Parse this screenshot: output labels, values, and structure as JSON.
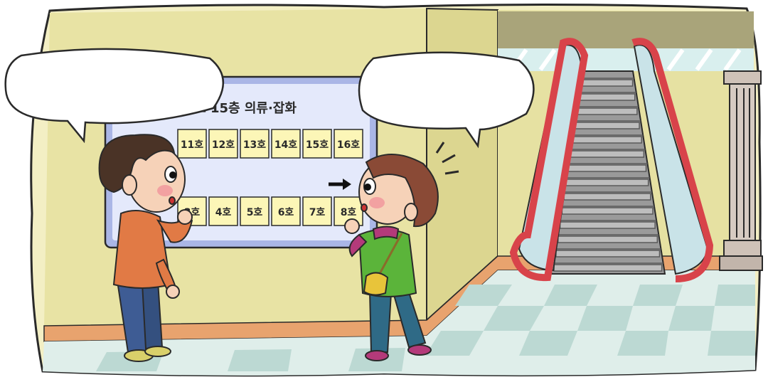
{
  "sign": {
    "title": "안내도 15층 의류·잡화",
    "top_rooms": [
      "11호",
      "12호",
      "13호",
      "14호",
      "15호",
      "16호"
    ],
    "bottom_rooms": [
      "3호",
      "4호",
      "5호",
      "6호",
      "7호",
      "8호"
    ],
    "arrow_icon": "arrow-right-icon"
  },
  "speech_bubbles": [
    {
      "speaker": "boy",
      "text": ""
    },
    {
      "speaker": "girl",
      "text": ""
    }
  ],
  "colors": {
    "wall": "#e8e3a4",
    "wall_dark": "#d8d28a",
    "floor_light": "#dfeeea",
    "floor_tile": "#bcd9d3",
    "baseboard": "#e8a36e",
    "sign_frame": "#aab6e6",
    "room_card": "#fcf6b7",
    "escalator_rail": "#d8434a",
    "outline": "#2a2a2a"
  }
}
